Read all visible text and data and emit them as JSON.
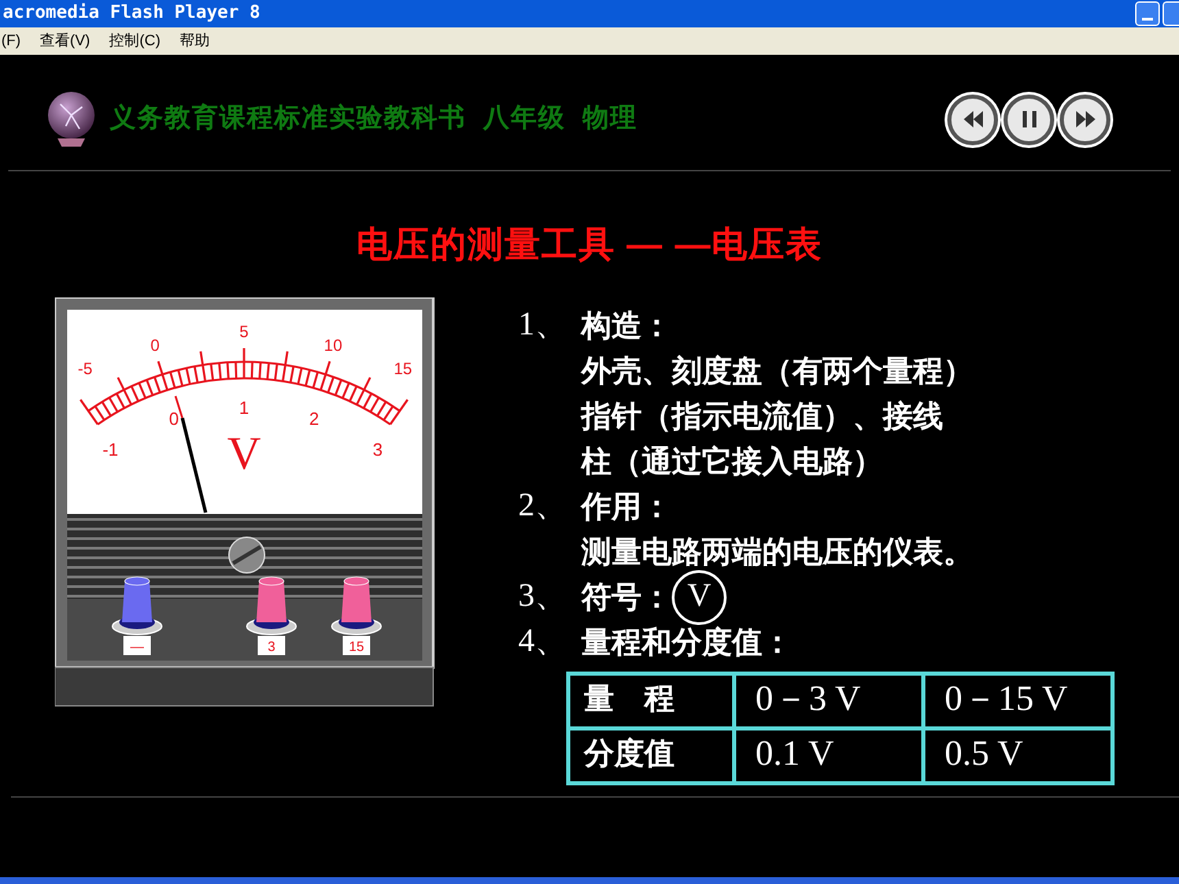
{
  "window": {
    "title": "acromedia Flash Player 8"
  },
  "menu": [
    "(F)",
    "查看(V)",
    "控制(C)",
    "帮助"
  ],
  "header": {
    "title": "义务教育课程标准实验教科书  八年级  物理"
  },
  "playback_buttons": [
    {
      "kind": "rewind"
    },
    {
      "kind": "pause"
    },
    {
      "kind": "forward"
    }
  ],
  "slide_title": "电压的测量工具 — —电压表",
  "meter": {
    "top_scale": [
      "-5",
      "0",
      "5",
      "10",
      "15"
    ],
    "bottom_scale": [
      "-1",
      "0",
      "1",
      "2",
      "3"
    ],
    "unit": "V",
    "terminals": [
      "—",
      "3",
      "15"
    ]
  },
  "points": [
    {
      "number": "1、",
      "heading": "构造：",
      "lines": [
        "外壳、刻度盘（有两个量程）",
        "指针（指示电流值）、接线",
        "柱（通过它接入电路）"
      ]
    },
    {
      "number": "2、",
      "heading": "作用：",
      "lines": [
        "测量电路两端的电压的仪表。"
      ]
    },
    {
      "number": "3、",
      "heading": "符号：",
      "symbol": "V"
    },
    {
      "number": "4、",
      "heading": "量程和分度值："
    }
  ],
  "table": {
    "rows": [
      [
        "量　程",
        "0－3 V",
        "0－15 V"
      ],
      [
        "分度值",
        "0.1 V",
        "0.5 V"
      ]
    ]
  }
}
